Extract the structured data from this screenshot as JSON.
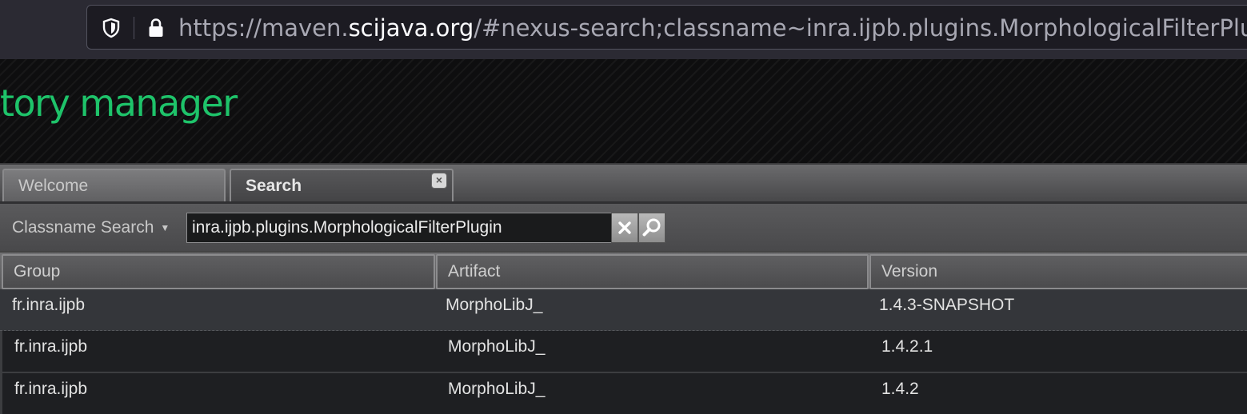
{
  "browser": {
    "url_prefix": "https://maven.",
    "url_host": "scijava.org",
    "url_suffix": "/#nexus-search;classname~inra.ijpb.plugins.MorphologicalFilterPlugin",
    "shield_icon": "shield-icon",
    "lock_icon": "lock-icon"
  },
  "banner": {
    "title": "tory manager",
    "accent_color": "#1ec36a"
  },
  "tabs": [
    {
      "label": "Welcome",
      "active": false
    },
    {
      "label": "Search",
      "active": true,
      "closable": true
    }
  ],
  "search": {
    "type_label": "Classname Search",
    "query": "inra.ijpb.plugins.MorphologicalFilterPlugin",
    "clear_icon": "close-icon",
    "search_icon": "magnifier-icon"
  },
  "grid": {
    "columns": [
      "Group",
      "Artifact",
      "Version"
    ],
    "rows": [
      {
        "group": "fr.inra.ijpb",
        "artifact": "MorphoLibJ_",
        "version": "1.4.3-SNAPSHOT"
      },
      {
        "group": "fr.inra.ijpb",
        "artifact": "MorphoLibJ_",
        "version": "1.4.2.1"
      },
      {
        "group": "fr.inra.ijpb",
        "artifact": "MorphoLibJ_",
        "version": "1.4.2"
      }
    ]
  }
}
